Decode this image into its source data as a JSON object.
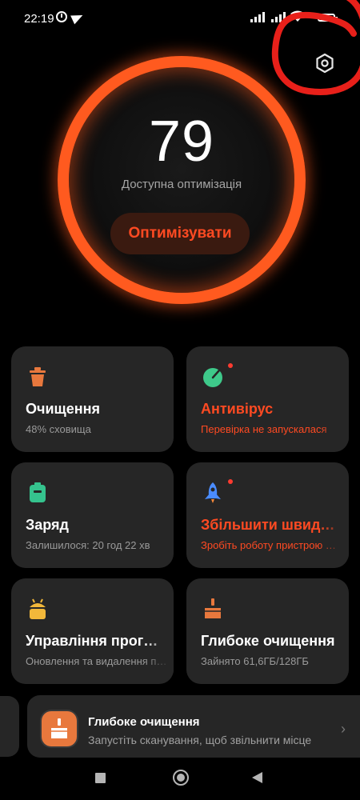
{
  "status_bar": {
    "time": "22:19",
    "icons": [
      "alarm-icon",
      "telegram-icon",
      "signal-icon",
      "signal-icon",
      "wifi-icon",
      "battery-icon"
    ]
  },
  "header": {
    "settings_icon": "gear-icon"
  },
  "score": {
    "value": "79",
    "caption": "Доступна оптимізація",
    "button_label": "Оптимізувати",
    "ring_color": "#ff5a1f"
  },
  "cards": [
    {
      "title": "Очищення",
      "subtitle": "48% сховища",
      "icon": "trash-bin-icon",
      "icon_color": "#e8783d",
      "alert": false,
      "dot": false
    },
    {
      "title": "Антивірус",
      "subtitle": "Перевірка не запускалася",
      "icon": "radar-icon",
      "icon_color": "#3ec98a",
      "alert": true,
      "dot": true
    },
    {
      "title": "Заряд",
      "subtitle": "Залишилося: 20 год 22 хв",
      "icon": "battery-icon",
      "icon_color": "#35c38e",
      "alert": false,
      "dot": false
    },
    {
      "title": "Збільшити швидкість",
      "subtitle": "Зробіть роботу пристрою швидшою",
      "icon": "rocket-icon",
      "icon_color": "#4a8cff",
      "alert": true,
      "dot": true
    },
    {
      "title": "Управління програмами",
      "subtitle": "Оновлення та видалення програм",
      "icon": "android-icon",
      "icon_color": "#f2b83a",
      "alert": false,
      "dot": false
    },
    {
      "title": "Глибоке очищення",
      "subtitle": "Зайнято 61,6ГБ/128ГБ",
      "icon": "broom-icon",
      "icon_color": "#e8783d",
      "alert": false,
      "dot": false
    }
  ],
  "banner": {
    "title": "Глибоке очищення",
    "subtitle": "Запустіть сканування, щоб звільнити місце",
    "icon": "broom-icon",
    "icon_bg": "#e8783d"
  },
  "navbar": {
    "buttons": [
      "recents-button",
      "home-button",
      "back-button"
    ]
  },
  "accent_colors": {
    "alert": "#ff4a22",
    "annotation": "#e8201a"
  }
}
